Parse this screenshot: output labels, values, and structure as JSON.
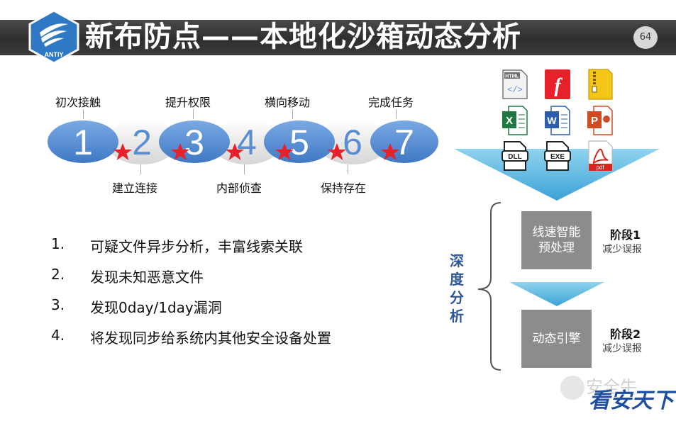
{
  "header": {
    "title": "新布防点——本地化沙箱动态分析",
    "page_number": "64",
    "logo_text": "ANTIY"
  },
  "process": {
    "steps": [
      "1",
      "2",
      "3",
      "4",
      "5",
      "6",
      "7"
    ],
    "top_labels": [
      "初次接触",
      "提升权限",
      "横向移动",
      "完成任务"
    ],
    "bottom_labels": [
      "建立连接",
      "内部侦查",
      "保持存在"
    ]
  },
  "list": [
    {
      "num": "1.",
      "text": "可疑文件异步分析，丰富线索关联"
    },
    {
      "num": "2.",
      "text": "发现未知恶意文件"
    },
    {
      "num": "3.",
      "text": "发现0day/1day漏洞"
    },
    {
      "num": "4.",
      "text": "将发现同步给系统内其他安全设备处置"
    }
  ],
  "file_icons": [
    "html-file-icon",
    "flash-file-icon",
    "archive-file-icon",
    "excel-file-icon",
    "word-file-icon",
    "powerpoint-file-icon",
    "dll-file-icon",
    "exe-file-icon",
    "pdf-file-icon"
  ],
  "icon_texts": {
    "html": "HTML",
    "dll": "DLL",
    "exe": "EXE",
    "pdf": "pdf"
  },
  "analysis": {
    "side_label": "深度分析",
    "box1": "线速智能预处理",
    "box2": "动态引擎",
    "stage1_title": "阶段1",
    "stage1_sub": "减少误报",
    "stage2_title": "阶段2",
    "stage2_sub": "减少误报"
  },
  "watermark": {
    "text1": "安全牛",
    "text2": "看安天下"
  },
  "colors": {
    "accent_blue": "#5b8ed1",
    "gray_box": "#8c8c8c",
    "star_red": "#e8202a"
  }
}
